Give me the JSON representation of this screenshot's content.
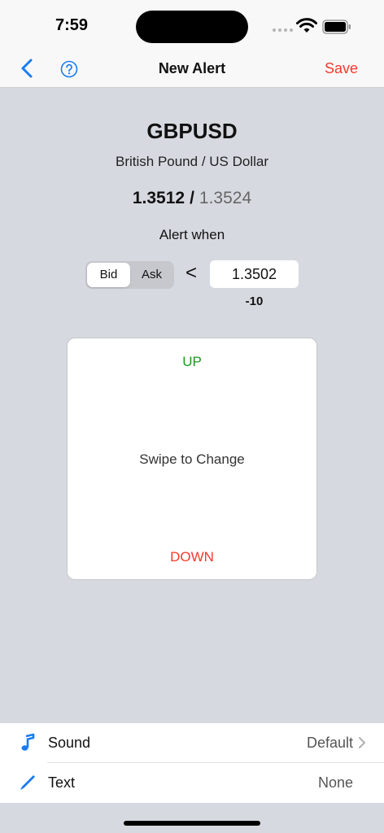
{
  "status": {
    "time": "7:59"
  },
  "nav": {
    "title": "New Alert",
    "save_label": "Save"
  },
  "instrument": {
    "symbol": "GBPUSD",
    "description": "British Pound / US Dollar",
    "bid": "1.3512",
    "separator": "/",
    "ask": "1.3524"
  },
  "alert": {
    "prompt": "Alert when",
    "price_sides": [
      "Bid",
      "Ask"
    ],
    "selected_side": "Bid",
    "comparator": "<",
    "threshold": "1.3502",
    "pip_offset": "-10"
  },
  "swipe": {
    "up_label": "UP",
    "hint": "Swipe to Change",
    "down_label": "DOWN"
  },
  "settings": [
    {
      "label": "Sound",
      "value": "Default",
      "icon": "music-note-icon"
    },
    {
      "label": "Text",
      "value": "None",
      "icon": "pencil-icon"
    }
  ],
  "colors": {
    "accent": "#1a7cf0",
    "save": "#f23a2c",
    "up": "#199a1f",
    "down": "#f23a2c",
    "background": "#d6d9e0"
  }
}
